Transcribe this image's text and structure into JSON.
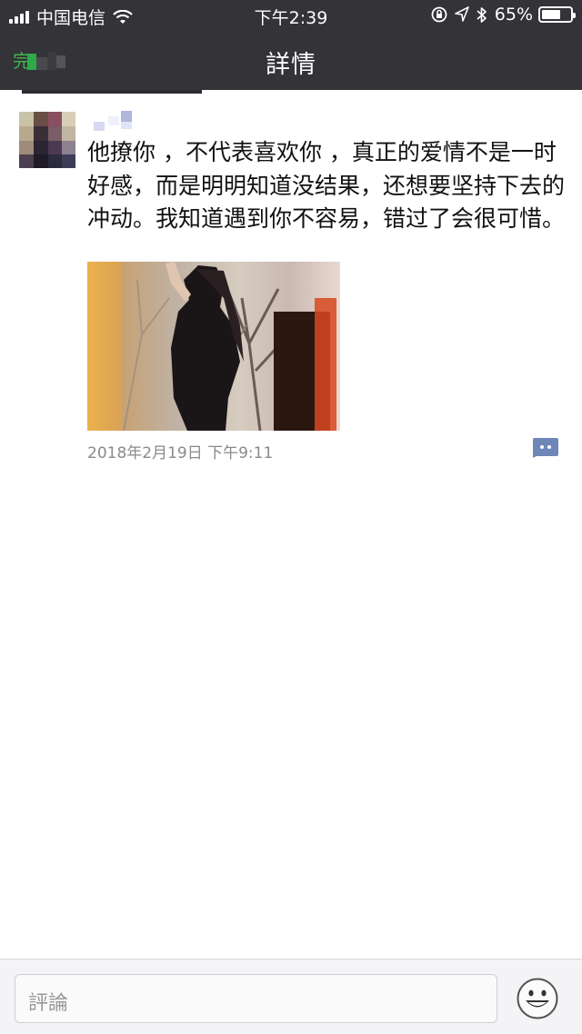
{
  "status_bar": {
    "carrier": "中国电信",
    "time": "下午2:39",
    "battery_percent": "65%",
    "battery_level": 0.65
  },
  "nav": {
    "back_glyph": "完",
    "title": "詳情"
  },
  "post": {
    "text": "他撩你 ，不代表喜欢你 ，真正的爱情不是一时好感，而是明明知道没结果，还想要坚持下去的冲动。我知道遇到你不容易，错过了会很可惜。",
    "timestamp": "2018年2月19日 下午9:11",
    "image_icon": "photo-girl-trees",
    "comment_icon": "comment-bubble-icon"
  },
  "comment_bar": {
    "placeholder": "評論",
    "emoji_icon": "smiley-icon"
  },
  "colors": {
    "topbar": "#333338",
    "accent_green": "#3fb84f",
    "comment_icon": "#6f87b8"
  }
}
